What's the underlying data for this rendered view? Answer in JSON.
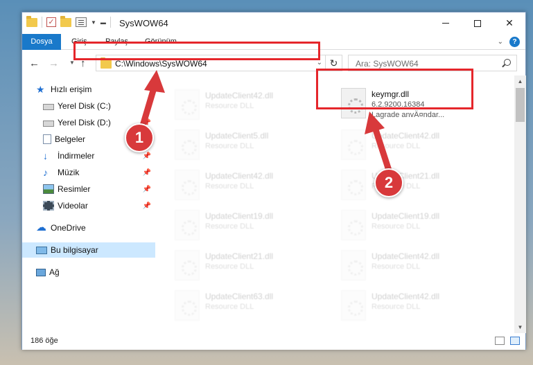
{
  "window": {
    "title": "SysWOW64"
  },
  "ribbon": {
    "tabs": [
      "Dosya",
      "Giriş",
      "Paylaş",
      "Görünüm"
    ],
    "active_tab": "Dosya",
    "help": "?"
  },
  "navigation": {
    "address": "C:\\Windows\\SysWOW64",
    "search_placeholder": "Ara: SysWOW64"
  },
  "sidebar": {
    "items": [
      {
        "label": "Hızlı erişim",
        "icon": "star-icon"
      },
      {
        "label": "Yerel Disk (C:)",
        "icon": "drive-icon"
      },
      {
        "label": "Yerel Disk (D:)",
        "icon": "drive-icon"
      },
      {
        "label": "Belgeler",
        "icon": "documents-icon"
      },
      {
        "label": "İndirmeler",
        "icon": "download-icon"
      },
      {
        "label": "Müzik",
        "icon": "music-icon"
      },
      {
        "label": "Resimler",
        "icon": "pictures-icon"
      },
      {
        "label": "Videolar",
        "icon": "video-icon"
      },
      {
        "label": "OneDrive",
        "icon": "cloud-icon"
      },
      {
        "label": "Bu bilgisayar",
        "icon": "computer-icon"
      },
      {
        "label": "Ağ",
        "icon": "network-icon"
      }
    ],
    "selected": "Bu bilgisayar"
  },
  "files": {
    "left_column": [
      {
        "name": "UpdateClient42.dll",
        "type": "Resource DLL"
      },
      {
        "name": "UpdateClient5.dll",
        "type": "Resource DLL"
      },
      {
        "name": "UpdateClient42.dll",
        "type": "Resource DLL"
      },
      {
        "name": "UpdateClient19.dll",
        "type": "Resource DLL"
      },
      {
        "name": "UpdateClient21.dll",
        "type": "Resource DLL"
      },
      {
        "name": "UpdateClient63.dll",
        "type": "Resource DLL"
      }
    ],
    "right_column": [
      {
        "name": "keymgr.dll",
        "type": "6.2.9200.16384",
        "desc": "Lagrade anvÄ¤ndar..."
      },
      {
        "name": "UpdateClient42.dll",
        "type": "Resource DLL"
      },
      {
        "name": "UpdateClient21.dll",
        "type": "Resource DLL"
      },
      {
        "name": "UpdateClient19.dll",
        "type": "Resource DLL"
      },
      {
        "name": "UpdateClient42.dll",
        "type": "Resource DLL"
      },
      {
        "name": "UpdateClient42.dll",
        "type": "Resource DLL"
      }
    ]
  },
  "status": {
    "count": "186 öğe"
  },
  "annotations": {
    "step1": "1",
    "step2": "2",
    "color": "#e5262b"
  }
}
